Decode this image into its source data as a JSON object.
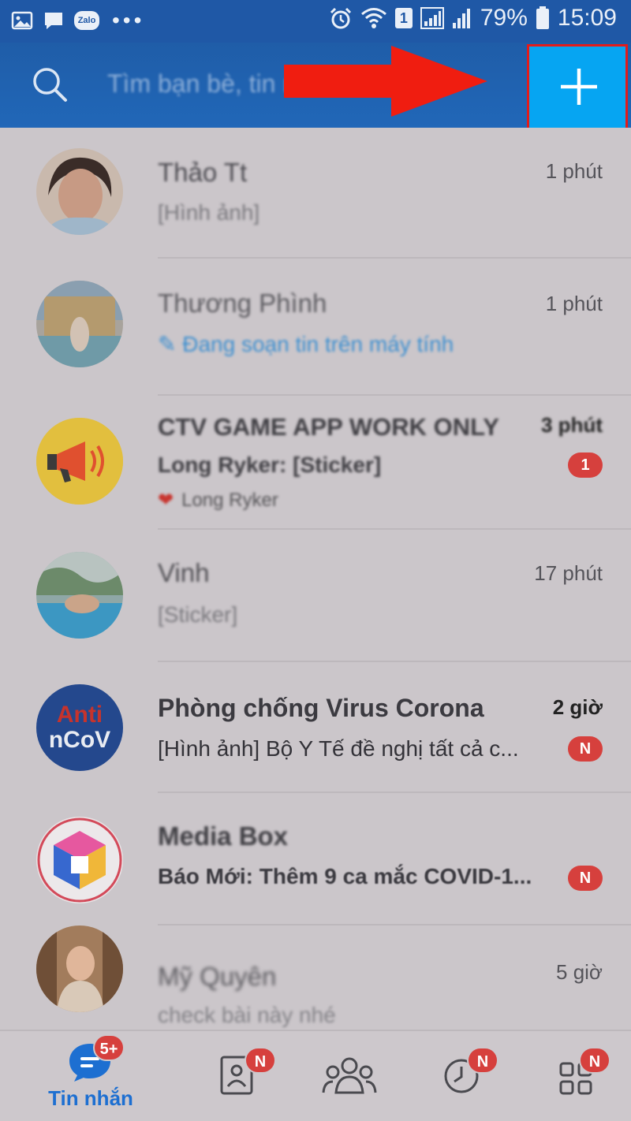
{
  "status_bar": {
    "zalo_label": "Zalo",
    "sim_label": "1",
    "battery": "79%",
    "time": "15:09"
  },
  "search": {
    "placeholder": "Tìm bạn bè, tin nhắn ..."
  },
  "conversations": [
    {
      "name": "Thảo Tt",
      "message": "[Hình ảnh]",
      "time": "1 phút"
    },
    {
      "name": "Thương Phình",
      "message": "Đang soạn tin trên máy tính",
      "time": "1 phút"
    },
    {
      "name": "CTV GAME APP WORK ONLY",
      "message": "Long Ryker: [Sticker]",
      "reaction": "Long Ryker",
      "time": "3 phút",
      "badge": "1"
    },
    {
      "name": "Vinh",
      "message": "[Sticker]",
      "time": "17 phút"
    },
    {
      "name": "Phòng chống Virus Corona",
      "message": "[Hình ảnh] Bộ Y Tế đề nghị tất cả c...",
      "time": "2 giờ",
      "badge": "N",
      "avatar_text_1": "Anti",
      "avatar_text_2": "nCoV"
    },
    {
      "name": "Media Box",
      "message": "Báo Mới: Thêm 9 ca mắc COVID-1...",
      "badge": "N"
    },
    {
      "name": "Mỹ Quyên",
      "message": "check bài này nhé",
      "time": "5 giờ"
    }
  ],
  "bottom_nav": {
    "messages_label": "Tin nhắn",
    "messages_badge": "5+",
    "contacts_badge": "N",
    "timeline_badge": "N",
    "more_badge": "N"
  },
  "colors": {
    "header": "#1f5da8",
    "plus_button": "#06a5f2",
    "highlight_border": "#e21b1b",
    "arrow": "#f01d10",
    "badge": "#d6403d",
    "active_tab": "#1d6fd1"
  }
}
